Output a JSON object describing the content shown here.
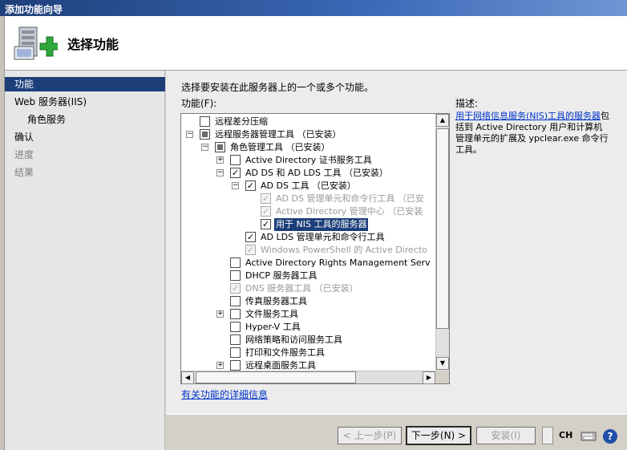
{
  "window": {
    "title": "添加功能向导"
  },
  "header": {
    "title": "选择功能"
  },
  "nav": {
    "items": [
      {
        "label": "功能",
        "state": "selected"
      },
      {
        "label": "Web 服务器(IIS)",
        "state": "normal"
      },
      {
        "label": "角色服务",
        "state": "sub"
      },
      {
        "label": "确认",
        "state": "normal"
      },
      {
        "label": "进度",
        "state": "dim"
      },
      {
        "label": "结果",
        "state": "dim"
      }
    ]
  },
  "main": {
    "instruction": "选择要安装在此服务器上的一个或多个功能。",
    "features_label": "功能(F):",
    "tree": [
      "远程差分压缩",
      "远程服务器管理工具  （已安装）",
      "角色管理工具  （已安装）",
      "Active Directory 证书服务工具",
      "AD DS 和 AD LDS 工具  （已安装）",
      "AD DS 工具  （已安装）",
      "AD DS 管理单元和命令行工具  （已安",
      "Active Directory 管理中心  （已安装",
      "用于 NIS 工具的服务器",
      "AD LDS 管理单元和命令行工具",
      "Windows PowerShell 的 Active Directo",
      "Active Directory Rights Management Serv",
      "DHCP 服务器工具",
      "DNS 服务器工具  （已安装）",
      "传真服务器工具",
      "文件服务工具",
      "Hyper-V 工具",
      "网络策略和访问服务工具",
      "打印和文件服务工具",
      "远程桌面服务工具"
    ],
    "more_info_link": "有关功能的详细信息"
  },
  "description": {
    "heading": "描述:",
    "link_text": "用于网络信息服务(NIS)工具的服务器",
    "body": "包括到 Active Directory 用户和计算机管理单元的扩展及 ypclear.exe 命令行工具。"
  },
  "buttons": {
    "prev": "< 上一步(P)",
    "next": "下一步(N) >",
    "install": "安装(I)"
  },
  "tray": {
    "lang": "CH",
    "help_glyph": "?"
  },
  "colors": {
    "accent": "#1c3f7a",
    "link": "#0033cc"
  }
}
